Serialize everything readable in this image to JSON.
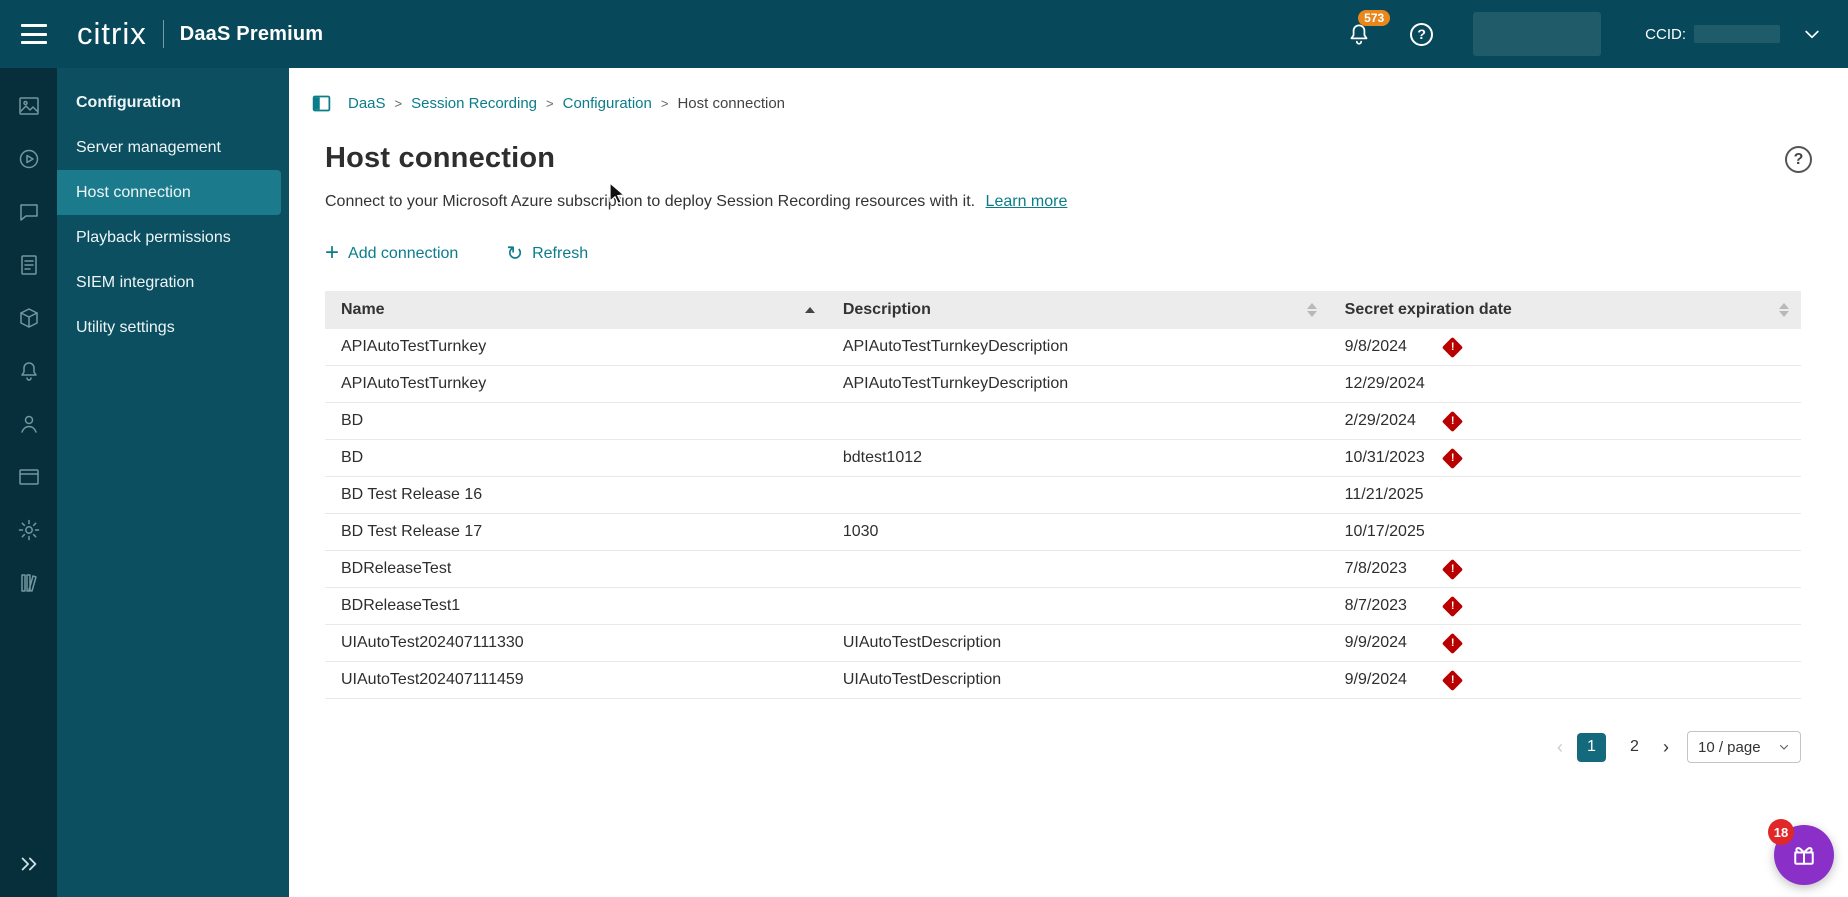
{
  "header": {
    "brand": "citrix",
    "product": "DaaS Premium",
    "notification_count": "573",
    "help_glyph": "?",
    "ccid_label": "CCID:"
  },
  "sidebar": {
    "section_label": "Configuration",
    "items": [
      {
        "label": "Server management",
        "active": false
      },
      {
        "label": "Host connection",
        "active": true
      },
      {
        "label": "Playback permissions",
        "active": false
      },
      {
        "label": "SIEM integration",
        "active": false
      },
      {
        "label": "Utility settings",
        "active": false
      }
    ]
  },
  "breadcrumb": {
    "items": [
      {
        "label": "DaaS"
      },
      {
        "label": "Session Recording"
      },
      {
        "label": "Configuration"
      },
      {
        "label": "Host connection"
      }
    ],
    "separator": ">"
  },
  "page": {
    "title": "Host connection",
    "description": "Connect to your Microsoft Azure subscription to deploy Session Recording resources with it.",
    "learn_more_label": "Learn more",
    "help_glyph": "?",
    "add_connection_label": "Add connection",
    "refresh_label": "Refresh",
    "plus_glyph": "+",
    "refresh_glyph": "↻"
  },
  "table": {
    "columns": [
      "Name",
      "Description",
      "Secret expiration date"
    ],
    "sort": {
      "column": "Name",
      "direction": "asc"
    },
    "warning_glyph": "!",
    "rows": [
      {
        "name": "APIAutoTestTurnkey",
        "description": "APIAutoTestTurnkeyDescription",
        "expiration": "9/8/2024",
        "warning": true
      },
      {
        "name": "APIAutoTestTurnkey",
        "description": "APIAutoTestTurnkeyDescription",
        "expiration": "12/29/2024",
        "warning": false
      },
      {
        "name": "BD",
        "description": "",
        "expiration": "2/29/2024",
        "warning": true
      },
      {
        "name": "BD",
        "description": "bdtest1012",
        "expiration": "10/31/2023",
        "warning": true
      },
      {
        "name": "BD Test Release 16",
        "description": "",
        "expiration": "11/21/2025",
        "warning": false
      },
      {
        "name": "BD Test Release 17",
        "description": "1030",
        "expiration": "10/17/2025",
        "warning": false
      },
      {
        "name": "BDReleaseTest",
        "description": "",
        "expiration": "7/8/2023",
        "warning": true
      },
      {
        "name": "BDReleaseTest1",
        "description": "",
        "expiration": "8/7/2023",
        "warning": true
      },
      {
        "name": "UIAutoTest202407111330",
        "description": "UIAutoTestDescription",
        "expiration": "9/9/2024",
        "warning": true
      },
      {
        "name": "UIAutoTest202407111459",
        "description": "UIAutoTestDescription",
        "expiration": "9/9/2024",
        "warning": true
      }
    ]
  },
  "pagination": {
    "prev_glyph": "‹",
    "next_glyph": "›",
    "pages": [
      "1",
      "2"
    ],
    "current_page": "1",
    "page_size_label": "10 / page"
  },
  "assistant": {
    "badge_count": "18"
  },
  "icons": [
    "menu-icon",
    "bell-icon",
    "help-icon",
    "chevron-down-icon",
    "dashboard-icon",
    "monitoring-icon",
    "chat-icon",
    "logs-icon",
    "services-icon",
    "notifications-icon",
    "identity-icon",
    "workspace-icon",
    "settings-icon",
    "library-icon",
    "expand-rail-icon",
    "breadcrumb-panel-icon",
    "sort-asc-icon",
    "sort-icon",
    "warning-diamond-icon",
    "plus-icon",
    "refresh-icon",
    "assistant-gift-icon",
    "mouse-cursor"
  ],
  "colors": {
    "header_teal": "#07495a",
    "rail_teal": "#062f3b",
    "sidebar_teal": "#0b4f61",
    "active_item_teal": "#1b7b8c",
    "accent_link": "#0b7d8a",
    "warning_red": "#b90000",
    "notification_orange": "#e8871c",
    "assistant_purple": "#8b2fc9",
    "assistant_badge_red": "#e02828",
    "active_page_teal": "#15697d"
  }
}
